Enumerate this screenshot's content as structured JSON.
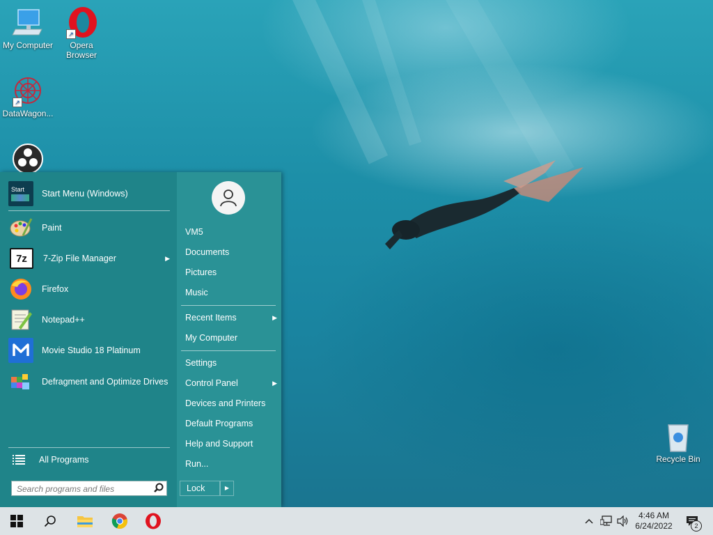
{
  "desktop": {
    "icons": [
      {
        "label": "My Computer",
        "icon": "computer-icon"
      },
      {
        "label": "Opera Browser",
        "icon": "opera-icon"
      },
      {
        "label": "DataWagon...",
        "icon": "datawagon-icon"
      },
      {
        "label": "",
        "icon": "obs-icon"
      },
      {
        "label": "Recycle Bin",
        "icon": "recycle-bin-icon"
      }
    ]
  },
  "start_menu": {
    "programs": [
      {
        "label": "Start Menu (Windows)",
        "icon": "start-menu-icon"
      },
      {
        "label": "Paint",
        "icon": "paint-icon"
      },
      {
        "label": "7-Zip File Manager",
        "icon": "7zip-icon",
        "submenu": true
      },
      {
        "label": "Firefox",
        "icon": "firefox-icon"
      },
      {
        "label": "Notepad++",
        "icon": "notepadpp-icon"
      },
      {
        "label": "Movie Studio 18 Platinum",
        "icon": "movie-studio-icon"
      },
      {
        "label": "Defragment and Optimize Drives",
        "icon": "defrag-icon"
      }
    ],
    "start_icon_text": "Start",
    "sevenzip_icon_text": "7z",
    "all_programs": "All Programs",
    "search": {
      "placeholder": "Search programs and files",
      "value": ""
    },
    "right": {
      "user": "VM5",
      "items_a": [
        "Documents",
        "Pictures",
        "Music"
      ],
      "recent_items": "Recent Items",
      "my_computer": "My Computer",
      "settings": "Settings",
      "control_panel": "Control Panel",
      "items_b": [
        "Devices and Printers",
        "Default Programs",
        "Help and Support",
        "Run..."
      ],
      "lock": "Lock"
    }
  },
  "taskbar": {
    "time": "4:46 AM",
    "date": "6/24/2022",
    "notification_count": "2"
  },
  "colors": {
    "menu_left": "#1f8489",
    "menu_right": "#2a9296",
    "taskbar": "#dde3e6"
  }
}
